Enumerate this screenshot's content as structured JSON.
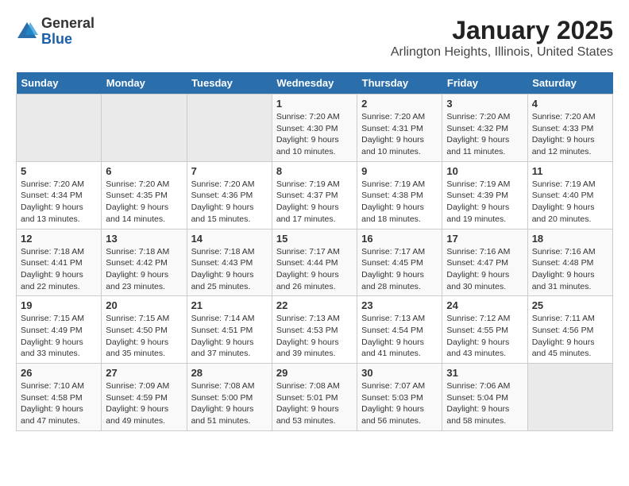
{
  "logo": {
    "general": "General",
    "blue": "Blue"
  },
  "title": "January 2025",
  "subtitle": "Arlington Heights, Illinois, United States",
  "days_of_week": [
    "Sunday",
    "Monday",
    "Tuesday",
    "Wednesday",
    "Thursday",
    "Friday",
    "Saturday"
  ],
  "weeks": [
    [
      {
        "day": "",
        "info": ""
      },
      {
        "day": "",
        "info": ""
      },
      {
        "day": "",
        "info": ""
      },
      {
        "day": "1",
        "info": "Sunrise: 7:20 AM\nSunset: 4:30 PM\nDaylight: 9 hours\nand 10 minutes."
      },
      {
        "day": "2",
        "info": "Sunrise: 7:20 AM\nSunset: 4:31 PM\nDaylight: 9 hours\nand 10 minutes."
      },
      {
        "day": "3",
        "info": "Sunrise: 7:20 AM\nSunset: 4:32 PM\nDaylight: 9 hours\nand 11 minutes."
      },
      {
        "day": "4",
        "info": "Sunrise: 7:20 AM\nSunset: 4:33 PM\nDaylight: 9 hours\nand 12 minutes."
      }
    ],
    [
      {
        "day": "5",
        "info": "Sunrise: 7:20 AM\nSunset: 4:34 PM\nDaylight: 9 hours\nand 13 minutes."
      },
      {
        "day": "6",
        "info": "Sunrise: 7:20 AM\nSunset: 4:35 PM\nDaylight: 9 hours\nand 14 minutes."
      },
      {
        "day": "7",
        "info": "Sunrise: 7:20 AM\nSunset: 4:36 PM\nDaylight: 9 hours\nand 15 minutes."
      },
      {
        "day": "8",
        "info": "Sunrise: 7:19 AM\nSunset: 4:37 PM\nDaylight: 9 hours\nand 17 minutes."
      },
      {
        "day": "9",
        "info": "Sunrise: 7:19 AM\nSunset: 4:38 PM\nDaylight: 9 hours\nand 18 minutes."
      },
      {
        "day": "10",
        "info": "Sunrise: 7:19 AM\nSunset: 4:39 PM\nDaylight: 9 hours\nand 19 minutes."
      },
      {
        "day": "11",
        "info": "Sunrise: 7:19 AM\nSunset: 4:40 PM\nDaylight: 9 hours\nand 20 minutes."
      }
    ],
    [
      {
        "day": "12",
        "info": "Sunrise: 7:18 AM\nSunset: 4:41 PM\nDaylight: 9 hours\nand 22 minutes."
      },
      {
        "day": "13",
        "info": "Sunrise: 7:18 AM\nSunset: 4:42 PM\nDaylight: 9 hours\nand 23 minutes."
      },
      {
        "day": "14",
        "info": "Sunrise: 7:18 AM\nSunset: 4:43 PM\nDaylight: 9 hours\nand 25 minutes."
      },
      {
        "day": "15",
        "info": "Sunrise: 7:17 AM\nSunset: 4:44 PM\nDaylight: 9 hours\nand 26 minutes."
      },
      {
        "day": "16",
        "info": "Sunrise: 7:17 AM\nSunset: 4:45 PM\nDaylight: 9 hours\nand 28 minutes."
      },
      {
        "day": "17",
        "info": "Sunrise: 7:16 AM\nSunset: 4:47 PM\nDaylight: 9 hours\nand 30 minutes."
      },
      {
        "day": "18",
        "info": "Sunrise: 7:16 AM\nSunset: 4:48 PM\nDaylight: 9 hours\nand 31 minutes."
      }
    ],
    [
      {
        "day": "19",
        "info": "Sunrise: 7:15 AM\nSunset: 4:49 PM\nDaylight: 9 hours\nand 33 minutes."
      },
      {
        "day": "20",
        "info": "Sunrise: 7:15 AM\nSunset: 4:50 PM\nDaylight: 9 hours\nand 35 minutes."
      },
      {
        "day": "21",
        "info": "Sunrise: 7:14 AM\nSunset: 4:51 PM\nDaylight: 9 hours\nand 37 minutes."
      },
      {
        "day": "22",
        "info": "Sunrise: 7:13 AM\nSunset: 4:53 PM\nDaylight: 9 hours\nand 39 minutes."
      },
      {
        "day": "23",
        "info": "Sunrise: 7:13 AM\nSunset: 4:54 PM\nDaylight: 9 hours\nand 41 minutes."
      },
      {
        "day": "24",
        "info": "Sunrise: 7:12 AM\nSunset: 4:55 PM\nDaylight: 9 hours\nand 43 minutes."
      },
      {
        "day": "25",
        "info": "Sunrise: 7:11 AM\nSunset: 4:56 PM\nDaylight: 9 hours\nand 45 minutes."
      }
    ],
    [
      {
        "day": "26",
        "info": "Sunrise: 7:10 AM\nSunset: 4:58 PM\nDaylight: 9 hours\nand 47 minutes."
      },
      {
        "day": "27",
        "info": "Sunrise: 7:09 AM\nSunset: 4:59 PM\nDaylight: 9 hours\nand 49 minutes."
      },
      {
        "day": "28",
        "info": "Sunrise: 7:08 AM\nSunset: 5:00 PM\nDaylight: 9 hours\nand 51 minutes."
      },
      {
        "day": "29",
        "info": "Sunrise: 7:08 AM\nSunset: 5:01 PM\nDaylight: 9 hours\nand 53 minutes."
      },
      {
        "day": "30",
        "info": "Sunrise: 7:07 AM\nSunset: 5:03 PM\nDaylight: 9 hours\nand 56 minutes."
      },
      {
        "day": "31",
        "info": "Sunrise: 7:06 AM\nSunset: 5:04 PM\nDaylight: 9 hours\nand 58 minutes."
      },
      {
        "day": "",
        "info": ""
      }
    ]
  ]
}
